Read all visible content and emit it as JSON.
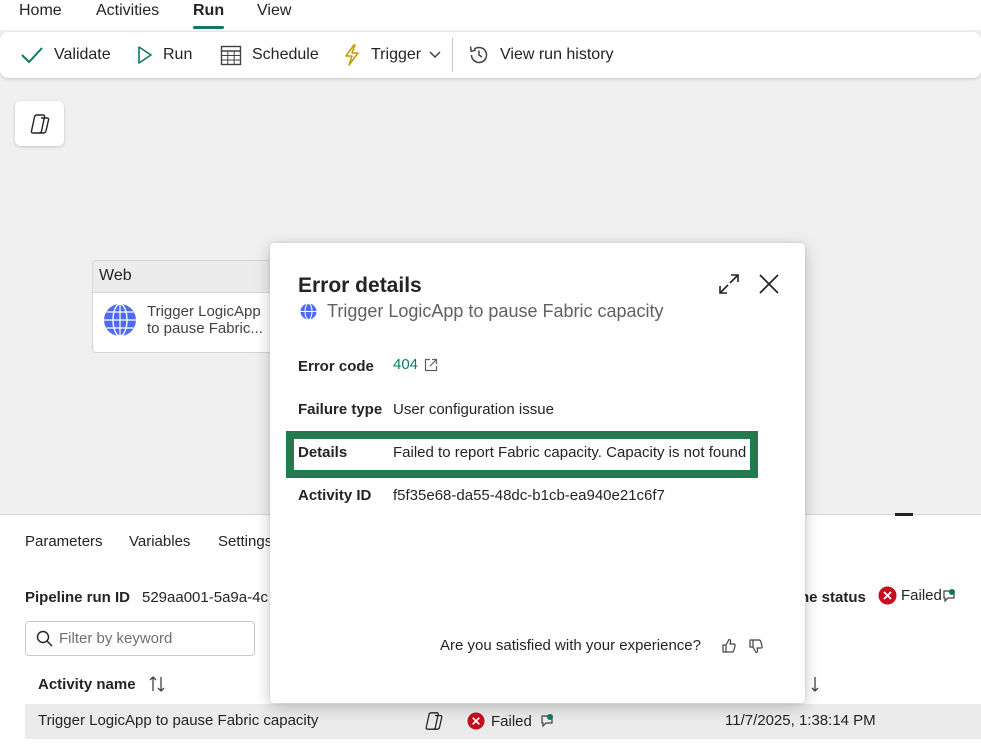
{
  "ribbon_tabs": [
    "Home",
    "Activities",
    "Run",
    "View"
  ],
  "toolbar": {
    "validate": "Validate",
    "run": "Run",
    "schedule": "Schedule",
    "trigger": "Trigger",
    "history": "View run history"
  },
  "canvas": {
    "activity": {
      "type": "Web",
      "name": "Trigger LogicApp to pause Fabric...",
      "name_line1": "Trigger LogicApp",
      "name_line2": "to pause Fabric..."
    }
  },
  "bottom_panel": {
    "tabs": [
      "Parameters",
      "Variables",
      "Settings"
    ],
    "run_id_label": "Pipeline run ID",
    "run_id_value": "529aa001-5a9a-4c",
    "status_label": "ne status",
    "status_value": "Failed",
    "filter_placeholder": "Filter by keyword",
    "columns": {
      "activity_name": "Activity name"
    },
    "rows": [
      {
        "activity_name": "Trigger LogicApp to pause Fabric capacity",
        "status": "Failed",
        "run_start": "11/7/2025, 1:38:14 PM"
      }
    ]
  },
  "dialog": {
    "title": "Error details",
    "subtitle": "Trigger LogicApp to pause Fabric capacity",
    "error_code_label": "Error code",
    "error_code_value": "404",
    "failure_type_label": "Failure type",
    "failure_type_value": "User configuration issue",
    "details_label": "Details",
    "details_value": "Failed to report Fabric capacity. Capacity is not found",
    "activity_id_label": "Activity ID",
    "activity_id_value": "f5f35e68-da55-48dc-b1cb-ea940e21c6f7",
    "feedback_prompt": "Are you satisfied with your experience?"
  },
  "colors": {
    "accent": "#117865",
    "error": "#c50f1f",
    "highlight": "#237a4e",
    "trigger_icon": "#c19c00"
  }
}
